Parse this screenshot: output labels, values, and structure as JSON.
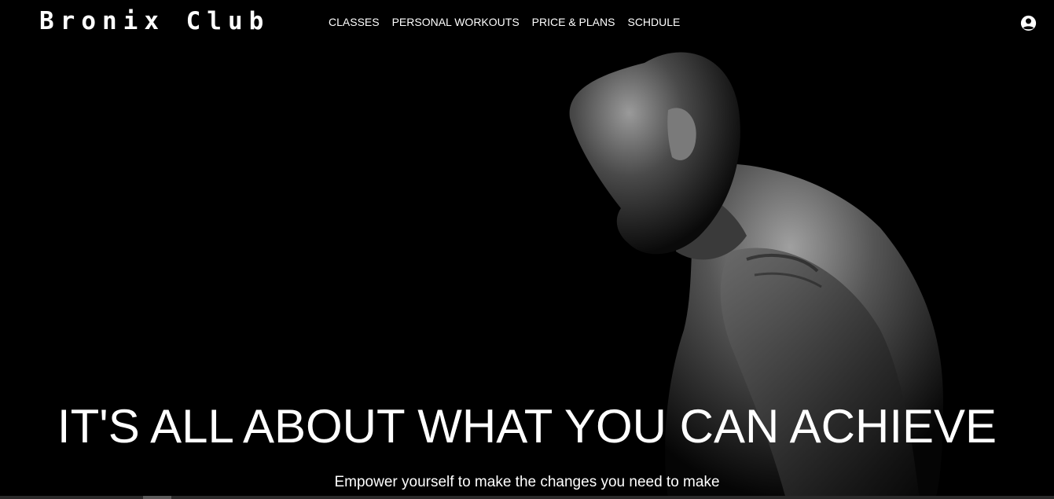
{
  "brand": {
    "name": "Bronix Club"
  },
  "nav": {
    "items": [
      {
        "label": "CLASSES"
      },
      {
        "label": "PERSONAL WORKOUTS"
      },
      {
        "label": "PRICE & PLANS"
      },
      {
        "label": "SCHDULE"
      }
    ],
    "account_icon": "user-circle-icon"
  },
  "hero": {
    "headline": "IT'S ALL ABOUT WHAT YOU CAN ACHIEVE",
    "subline": "Empower yourself to make the changes you need to make",
    "image": "athlete-photo"
  },
  "colors": {
    "background": "#000000",
    "text": "#ffffff"
  }
}
